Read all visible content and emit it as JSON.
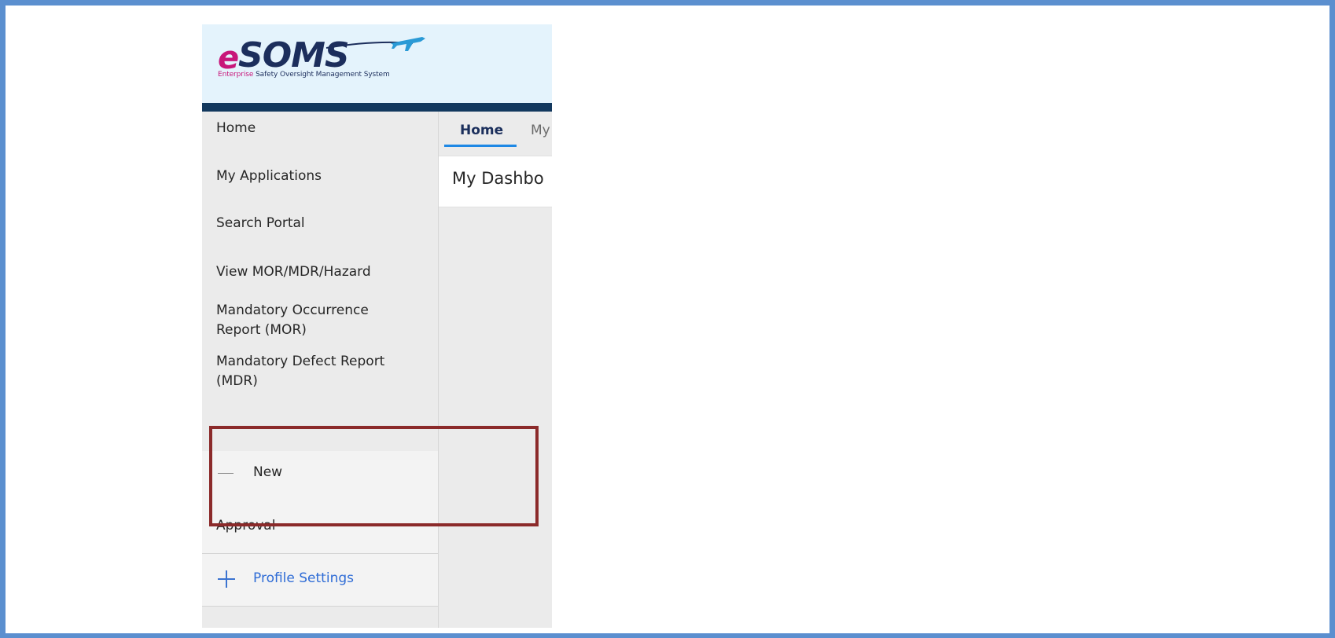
{
  "logo": {
    "brand_e": "e",
    "brand_rest": "SOMS",
    "tagline_accent": "Enterprise",
    "tagline_rest": "Safety Oversight Management System",
    "plane_icon": "airplane-icon"
  },
  "sidebar": {
    "items": [
      {
        "label": "Home"
      },
      {
        "label": "My Applications"
      },
      {
        "label": "Search Portal"
      },
      {
        "label": "View MOR/MDR/Hazard"
      },
      {
        "label_line1": "Mandatory Occurrence",
        "label_line2": "Report (MOR)"
      },
      {
        "label_line1": "Mandatory Defect Report",
        "label_line2": "(MDR)"
      }
    ],
    "submenu": {
      "collapse_icon": "minus-icon",
      "items": [
        {
          "label": "New"
        },
        {
          "label": "Approval"
        }
      ]
    },
    "profile": {
      "expand_icon": "plus-icon",
      "label": "Profile Settings"
    }
  },
  "tabs": [
    {
      "label": "Home",
      "active": true
    },
    {
      "label": "My"
    }
  ],
  "main": {
    "title": "My Dashbo"
  },
  "colors": {
    "frame": "#5b8fcf",
    "header_bar": "#12385e",
    "brand_pink": "#c8167a",
    "brand_navy": "#1c2e5c",
    "highlight": "#8b2a2a",
    "link_blue": "#2f6cd6"
  }
}
